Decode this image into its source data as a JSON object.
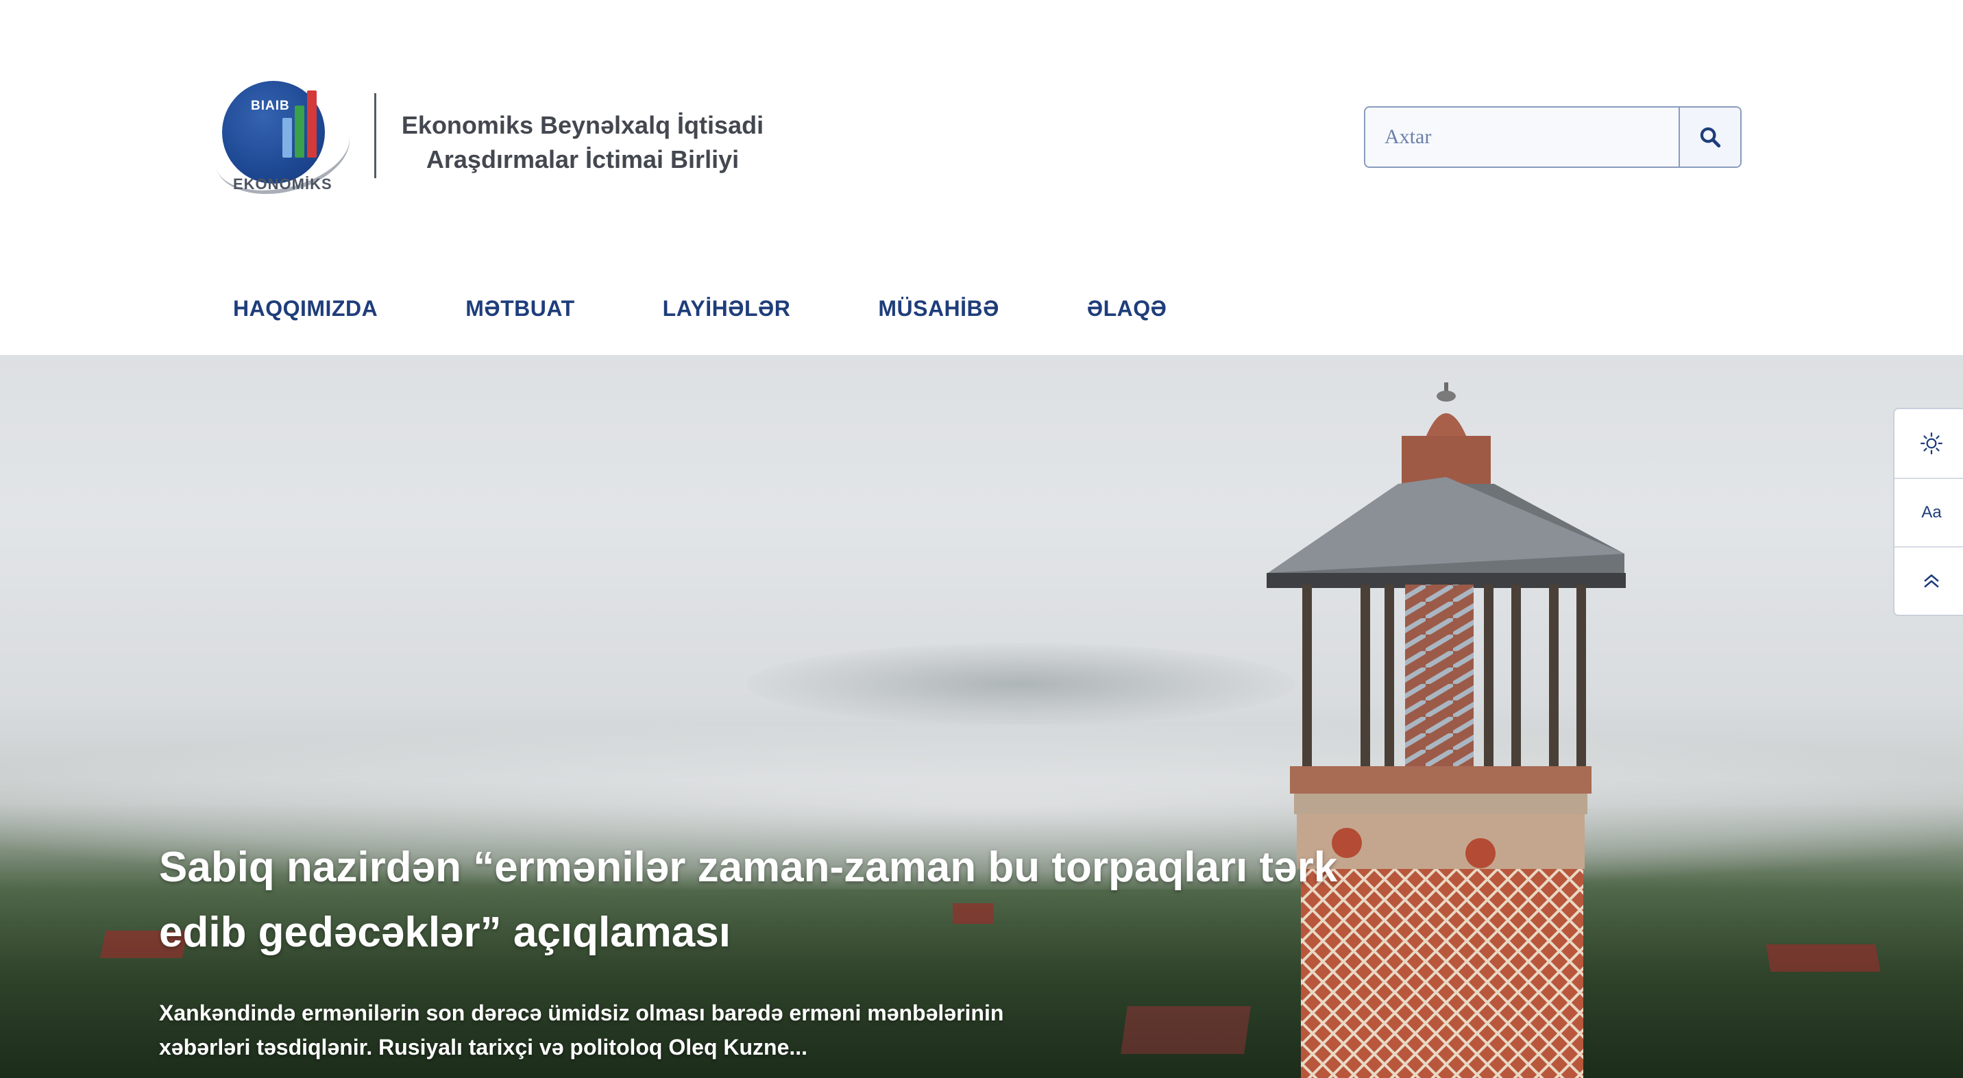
{
  "header": {
    "logo": {
      "abbr": "BIAIB",
      "word": "EKONOMİKS"
    },
    "org_name": "Ekonomiks Beynəlxalq İqtisadi Araşdırmalar İctimai Birliyi",
    "search": {
      "placeholder": "Axtar"
    }
  },
  "nav": {
    "items": [
      {
        "label": "HAQQIMIZDA"
      },
      {
        "label": "MƏTBUAT"
      },
      {
        "label": "LAYİHƏLƏR"
      },
      {
        "label": "MÜSAHİBƏ"
      },
      {
        "label": "ƏLAQƏ"
      }
    ]
  },
  "hero": {
    "title": "Sabiq nazirdən “ermənilər zaman-zaman bu torpaqları tərk edib gedəcəklər” açıqlaması",
    "description": "Xankəndində ermənilərin son dərəcə ümidsiz olması barədə erməni mənbələrinin xəbərləri təsdiqlənir. Rusiyalı tarixçi və politoloq Oleq Kuzne..."
  },
  "side_tools": {
    "font_size_label": "Aa"
  },
  "colors": {
    "nav_text": "#1e3d7a",
    "logo_blue": "#1f4a96",
    "logo_bar_light": "#7fb0e6",
    "logo_bar_green": "#3aa04a",
    "logo_bar_red": "#d43a3a"
  },
  "icons": [
    "search-icon",
    "sun-icon",
    "chevron-double-up-icon"
  ]
}
